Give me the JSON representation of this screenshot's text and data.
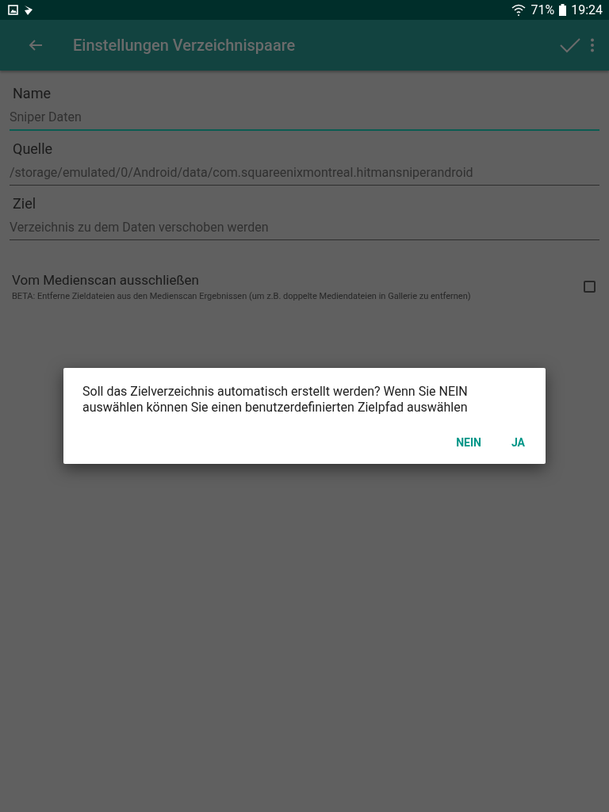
{
  "status_bar": {
    "battery": "71%",
    "time": "19:24"
  },
  "app_bar": {
    "title": "Einstellungen Verzeichnispaare"
  },
  "fields": [
    {
      "label": "Name",
      "value": "Sniper Daten",
      "focused": true
    },
    {
      "label": "Quelle",
      "value": "/storage/emulated/0/Android/data/com.squareenixmontreal.hitmansniperandroid",
      "focused": false
    },
    {
      "label": "Ziel",
      "placeholder": "Verzeichnis zu dem Daten verschoben werden",
      "focused": false
    }
  ],
  "option": {
    "title": "Vom Medienscan ausschließen",
    "description": "BETA: Entferne Zieldateien aus den Medienscan Ergebnissen (um z.B. doppelte Mediendateien in Gallerie zu entfernen)",
    "checked": false
  },
  "dialog": {
    "message": "Soll das Zielverzeichnis automatisch erstellt werden? Wenn Sie NEIN auswählen können Sie einen benutzerdefinierten Zielpfad auswählen",
    "buttons": [
      "NEIN",
      "JA"
    ]
  }
}
